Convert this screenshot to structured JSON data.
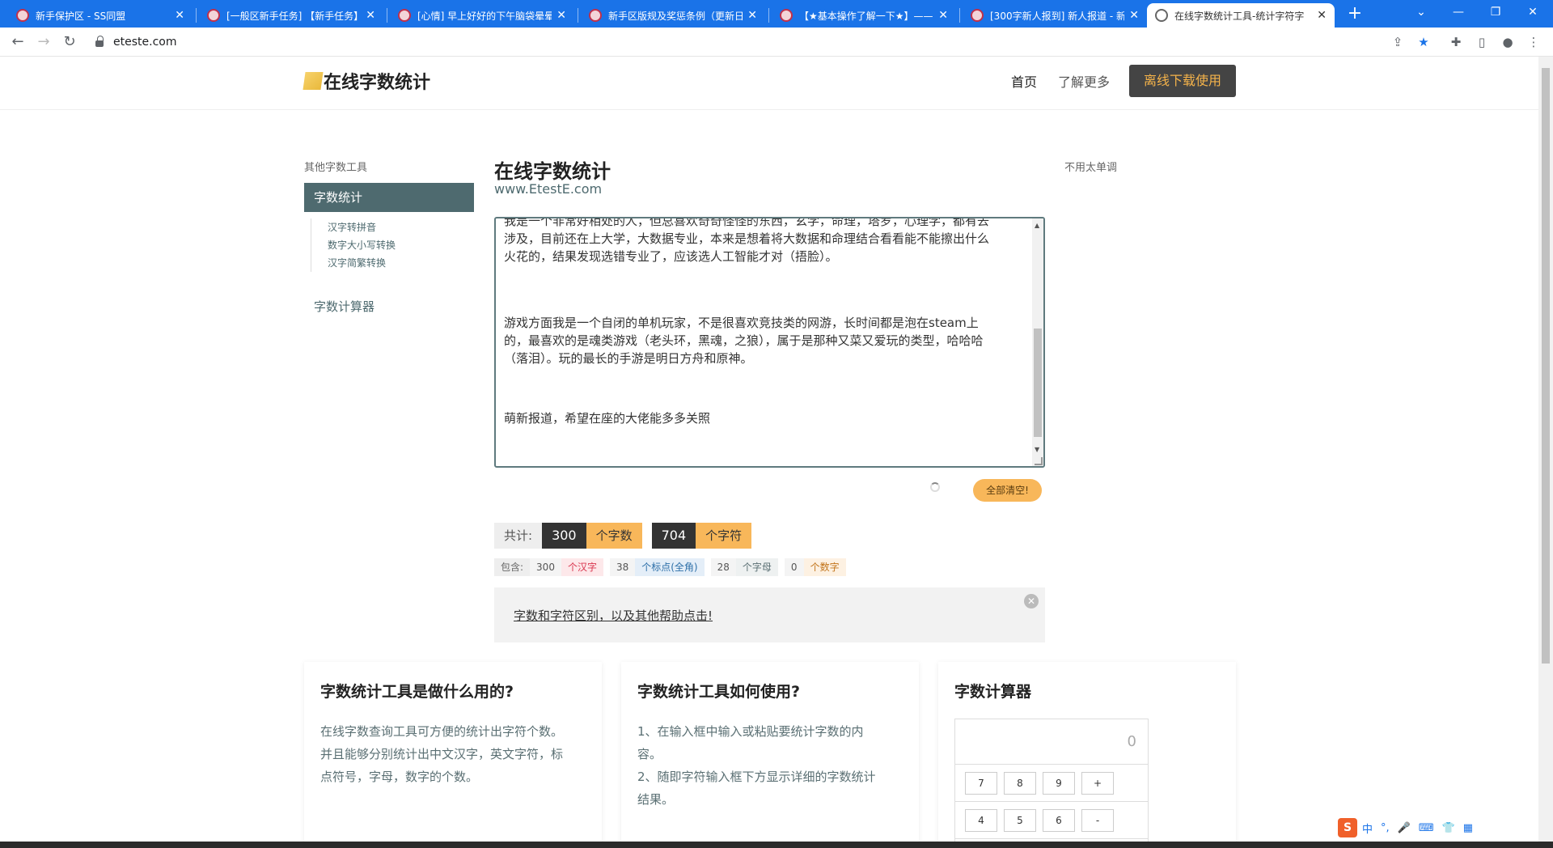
{
  "browser": {
    "tabs": [
      {
        "title": "新手保护区 - SS同盟",
        "active": false
      },
      {
        "title": "[一般区新手任务] 【新手任务】",
        "active": false
      },
      {
        "title": "[心情] 早上好好的下午脑袋晕晕",
        "active": false
      },
      {
        "title": "新手区版规及奖惩条例（更新日",
        "active": false
      },
      {
        "title": "【★基本操作了解一下★】——",
        "active": false
      },
      {
        "title": "[300字新人报到] 新人报道 - 新",
        "active": false
      },
      {
        "title": "在线字数统计工具-统计字符字",
        "active": true
      }
    ],
    "new_tab": "+",
    "url": "eteste.com",
    "colors": {
      "tabbar": "#1a73e8"
    }
  },
  "site": {
    "logo": "在线字数统计",
    "nav": {
      "home": "首页",
      "more": "了解更多",
      "download": "离线下载使用"
    }
  },
  "sidebar": {
    "title": "其他字数工具",
    "active": "字数统计",
    "sub_items": [
      "汉字转拼音",
      "数字大小写转换",
      "汉字简繁转换"
    ],
    "calc": "字数计算器"
  },
  "main": {
    "title": "在线字数统计",
    "subtitle": "www.EtestE.com",
    "right_note": "不用太单调",
    "text_lines": [
      "我是一个非常好相处的人，但总喜欢奇奇怪怪的东西，玄学，命理，塔罗，心理学，都有去",
      "涉及，目前还在上大学，大数据专业，本来是想着将大数据和命理结合看看能不能擦出什么",
      "火花的，结果发现选错专业了，应该选人工智能才对（捂脸）。",
      "游戏方面我是一个自闭的单机玩家，不是很喜欢竞技类的网游，长时间都是泡在steam上",
      "的，最喜欢的是魂类游戏（老头环，黑魂，之狼），属于是那种又菜又爱玩的类型，哈哈哈",
      "（落泪）。玩的最长的手游是明日方舟和原神。",
      "萌新报道，希望在座的大佬能多多关照"
    ],
    "clear_button": "全部清空!"
  },
  "totals": {
    "label": "共计:",
    "chars_count": "300",
    "chars_unit": "个字数",
    "symbols_count": "704",
    "symbols_unit": "个字符"
  },
  "details": {
    "label": "包含:",
    "items": [
      {
        "num": "300",
        "unit": "个汉字",
        "color": "#d9364f",
        "bg": "#fde8ea"
      },
      {
        "num": "38",
        "unit": "个标点(全角)",
        "color": "#2d6fa8",
        "bg": "#e4eef8"
      },
      {
        "num": "28",
        "unit": "个字母",
        "color": "#5a6f73",
        "bg": "#eef1f1"
      },
      {
        "num": "0",
        "unit": "个数字",
        "color": "#c2741a",
        "bg": "#fdf1e2"
      }
    ]
  },
  "help": {
    "text": "字数和字符区别，以及其他帮助点击!"
  },
  "cards": [
    {
      "title": "字数统计工具是做什么用的?",
      "body": [
        "在线字数查询工具可方便的统计出字符个数。",
        "并且能够分别统计出中文汉字，英文字符，标",
        "点符号，字母，数字的个数。"
      ]
    },
    {
      "title": "字数统计工具如何使用?",
      "body": [
        "1、在输入框中输入或粘贴要统计字数的内",
        "容。",
        "2、随即字符输入框下方显示详细的字数统计",
        "结果。"
      ]
    },
    {
      "title": "字数计算器",
      "display": "0",
      "rows": [
        [
          "7",
          "8",
          "9",
          "+"
        ],
        [
          "4",
          "5",
          "6",
          "-"
        ]
      ]
    }
  ],
  "ime": {
    "logo": "S",
    "items": [
      "中",
      "°,",
      "🎤",
      "⌨",
      "👕",
      "▦"
    ]
  }
}
